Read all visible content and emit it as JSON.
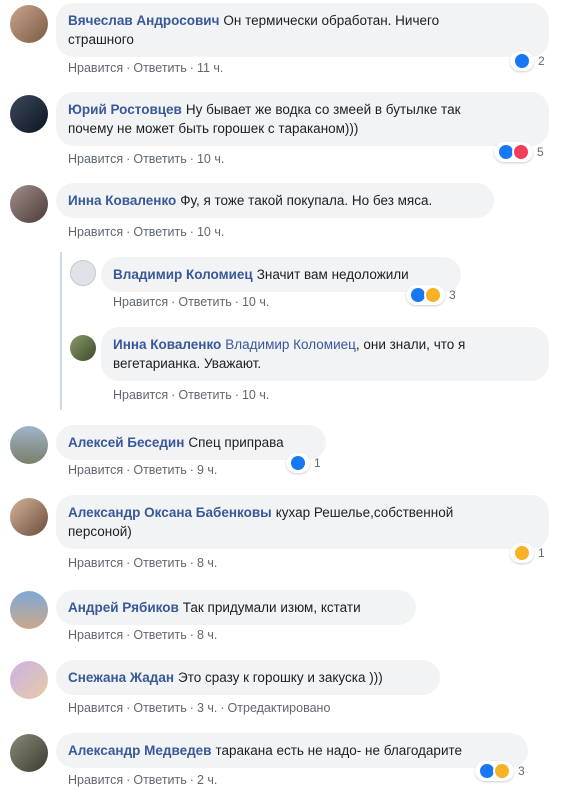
{
  "actions": {
    "like": "Нравится",
    "reply": "Ответить",
    "edited": "Отредактировано"
  },
  "comments": [
    {
      "author": "Вячеслав Андросович",
      "text_line1": "Он термически обработан. Ничего",
      "text_line2": "страшного",
      "time": "11 ч.",
      "reaction_count": "2"
    },
    {
      "author": "Юрий Ростовцев",
      "text_line1": "Ну бывает же водка со змеей в бутылке так",
      "text_line2": "почему не может быть горошек с тараканом)))",
      "time": "10 ч.",
      "reaction_count": "5"
    },
    {
      "author": "Инна Коваленко",
      "text": "Фу, я тоже такой покупала. Но без мяса.",
      "time": "10 ч."
    },
    {
      "author": "Владимир Коломиец",
      "text": "Значит вам недоложили",
      "time": "10 ч.",
      "reaction_count": "3"
    },
    {
      "author": "Инна Коваленко",
      "mention": "Владимир Коломиец",
      "text_line1_rest": ", они знали, что я",
      "text_line2": "вегетарианка. Уважают.",
      "time": "10 ч."
    },
    {
      "author": "Алексей Беседин",
      "text": "Спец приправа",
      "time": "9 ч.",
      "reaction_count": "1"
    },
    {
      "author": "Александр Оксана Бабенковы",
      "text_line1": "кухар Решелье,собственной",
      "text_line2": "персоной)",
      "time": "8 ч.",
      "reaction_count": "1"
    },
    {
      "author": "Андрей Рябиков",
      "text": "Так придумали изюм, кстати",
      "time": "8 ч."
    },
    {
      "author": "Снежана Жадан",
      "text": "Это сразу к горошку и закуска )))",
      "time": "3 ч."
    },
    {
      "author": "Александр Медведев",
      "text": "таракана есть не надо- не благодарите",
      "time": "2 ч.",
      "reaction_count": "3"
    }
  ]
}
